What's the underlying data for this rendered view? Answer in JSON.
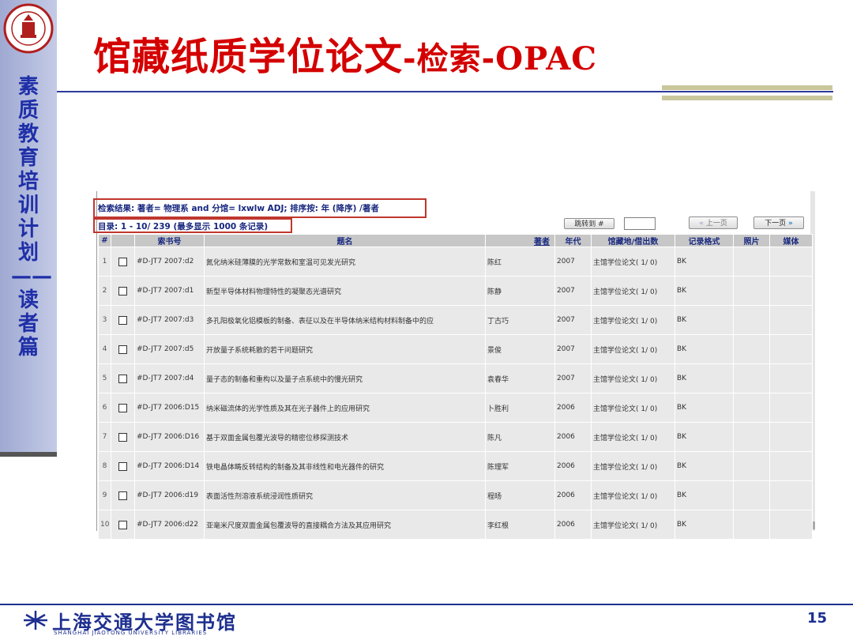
{
  "slide": {
    "title_cn": "馆藏纸质学位论文",
    "title_sep1": "-",
    "title_mid": "检索",
    "title_sep2": "-",
    "title_en": "OPAC",
    "side_text": "素质教育培训计划——读者篇",
    "page_number": "15"
  },
  "footer": {
    "library_cn": "上海交通大学图书馆",
    "library_en": "SHANGHAI JIAOTONG UNIVERSITY LIBRARIES"
  },
  "opac": {
    "status_query": "检索结果: 著者= 物理系  and 分馆= lxwlw ADJ; 排序按: 年 (降序) /著者",
    "status_range": "目录:   1 - 10/ 239 (最多显示  1000 条记录)",
    "jump_label": "跳转到 #",
    "jump_value": "",
    "prev_label": "上一页",
    "next_label": "下一页",
    "columns": [
      "#",
      "",
      "索书号",
      "题名",
      "著者",
      "年代",
      "馆藏地/借出数",
      "记录格式",
      "照片",
      "媒体"
    ],
    "rows": [
      {
        "n": "1",
        "call": "#D-JT7 2007:d2",
        "title": "氮化纳米硅薄膜的光学常数和室温可见发光研究",
        "author": "陈红",
        "year": "2007",
        "holdings": "主馆学位论文( 1/ 0)",
        "format": "BK"
      },
      {
        "n": "2",
        "call": "#D-JT7 2007:d1",
        "title": "新型半导体材料物理特性的凝聚态光谱研究",
        "author": "陈静",
        "year": "2007",
        "holdings": "主馆学位论文( 1/ 0)",
        "format": "BK"
      },
      {
        "n": "3",
        "call": "#D-JT7 2007:d3",
        "title": "多孔阳极氧化铝模板的制备、表征以及在半导体纳米结构材料制备中的应",
        "author": "丁古巧",
        "year": "2007",
        "holdings": "主馆学位论文( 1/ 0)",
        "format": "BK"
      },
      {
        "n": "4",
        "call": "#D-JT7 2007:d5",
        "title": "开放量子系统耗散的若干问题研究",
        "author": "景俊",
        "year": "2007",
        "holdings": "主馆学位论文( 1/ 0)",
        "format": "BK"
      },
      {
        "n": "5",
        "call": "#D-JT7 2007:d4",
        "title": "量子态的制备和重构以及量子点系统中的慢光研究",
        "author": "袁春华",
        "year": "2007",
        "holdings": "主馆学位论文( 1/ 0)",
        "format": "BK"
      },
      {
        "n": "6",
        "call": "#D-JT7 2006:D15",
        "title": "纳米磁流体的光学性质及其在光子器件上的应用研究",
        "author": "卜胜利",
        "year": "2006",
        "holdings": "主馆学位论文( 1/ 0)",
        "format": "BK"
      },
      {
        "n": "7",
        "call": "#D-JT7 2006:D16",
        "title": "基于双面金属包覆光波导的精密位移探测技术",
        "author": "陈凡",
        "year": "2006",
        "holdings": "主馆学位论文( 1/ 0)",
        "format": "BK"
      },
      {
        "n": "8",
        "call": "#D-JT7 2006:D14",
        "title": "铁电晶体畴反转结构的制备及其非线性和电光器件的研究",
        "author": "陈理军",
        "year": "2006",
        "holdings": "主馆学位论文( 1/ 0)",
        "format": "BK"
      },
      {
        "n": "9",
        "call": "#D-JT7 2006:d19",
        "title": "表面活性剂溶液系统浸润性质研究",
        "author": "程旸",
        "year": "2006",
        "holdings": "主馆学位论文( 1/ 0)",
        "format": "BK"
      },
      {
        "n": "10",
        "call": "#D-JT7 2006:d22",
        "title": "亚毫米尺度双面金属包覆波导的直接耦合方法及其应用研究",
        "author": "李红根",
        "year": "2006",
        "holdings": "主馆学位论文( 1/ 0)",
        "format": "BK"
      }
    ]
  },
  "colors": {
    "title_red": "#d40000",
    "sidebar_text": "#1f2fa8",
    "highlight_box": "#c0362c",
    "header_gray": "#c7c7c7",
    "row_gray": "#e9e9e9"
  }
}
